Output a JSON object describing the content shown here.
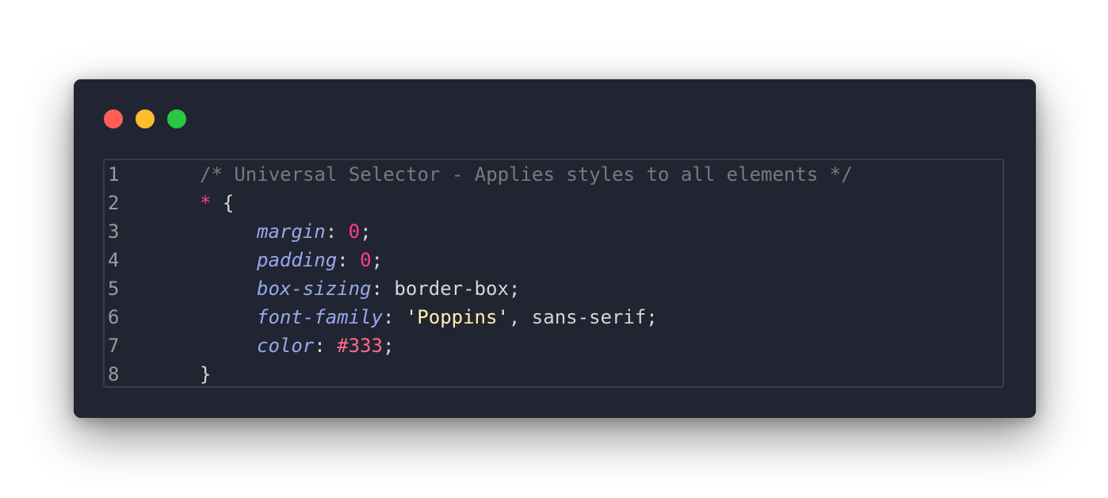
{
  "colors": {
    "window_bg": "#212532",
    "close": "#ff5f57",
    "minimize": "#febc2e",
    "maximize": "#28c840",
    "comment": "#797a7d",
    "selector": "#ff3c8c",
    "property": "#97a8ec",
    "number": "#ff3c8c",
    "string": "#fff0b0",
    "hex": "#ff6a8a"
  },
  "window_controls": [
    "close-icon",
    "minimize-icon",
    "maximize-icon"
  ],
  "lines": [
    {
      "num": "1",
      "comment": "/* Universal Selector - Applies styles to all elements */"
    },
    {
      "num": "2",
      "selector": "*",
      "brace": " {"
    },
    {
      "num": "3",
      "prop": "margin",
      "colon": ": ",
      "value": "0",
      "semi": ";"
    },
    {
      "num": "4",
      "prop": "padding",
      "colon": ": ",
      "value": "0",
      "semi": ";"
    },
    {
      "num": "5",
      "prop": "box-sizing",
      "colon": ": ",
      "value": "border-box",
      "semi": ";"
    },
    {
      "num": "6",
      "prop": "font-family",
      "colon": ": ",
      "string": "'Poppins'",
      "rest": ", sans-serif",
      "semi": ";"
    },
    {
      "num": "7",
      "prop": "color",
      "colon": ": ",
      "value": "#333",
      "semi": ";"
    },
    {
      "num": "8",
      "brace": "}"
    }
  ]
}
